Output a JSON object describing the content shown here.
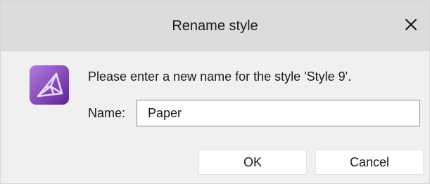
{
  "dialog": {
    "title": "Rename style",
    "close_icon": "close-icon",
    "app_icon": "affinity-photo-app-icon",
    "message": "Please enter a new name for the style 'Style 9'.",
    "name_label": "Name:",
    "name_value": "Paper",
    "ok_label": "OK",
    "cancel_label": "Cancel"
  },
  "colors": {
    "titlebar": "#dcdcdc",
    "body": "#f0f0f0",
    "icon_gradient_start": "#a66bd9",
    "icon_gradient_end": "#6a2fa6"
  }
}
